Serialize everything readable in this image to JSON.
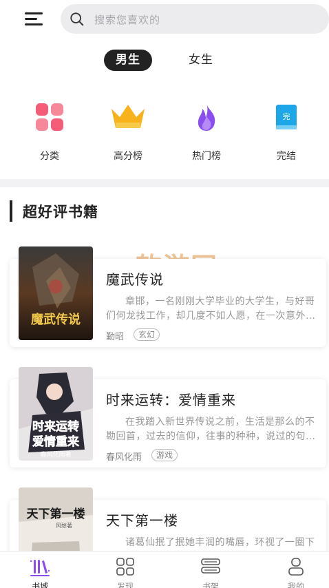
{
  "header": {
    "search_placeholder": "搜索您喜欢的"
  },
  "gender_tabs": {
    "male": "男生",
    "female": "女生",
    "selected": "男生"
  },
  "categories": [
    {
      "label": "分类",
      "icon": "grid-icon",
      "color": "#f2617a"
    },
    {
      "label": "高分榜",
      "icon": "crown-icon",
      "color": "#f7b21c"
    },
    {
      "label": "热门榜",
      "icon": "flame-icon",
      "color": "#8a4ef0"
    },
    {
      "label": "完结",
      "icon": "book-icon",
      "color": "#1ea7e8"
    }
  ],
  "section": {
    "title": "超好评书籍"
  },
  "watermark": "软游网",
  "books": [
    {
      "title": "魔武传说",
      "desc": "章邯，一名刚刚大学毕业的大学生，与好哥们何龙找工作，却几度不如人愿，在一次意外…",
      "author": "勤昭",
      "tag": "玄幻",
      "cover_text": "魔武传说"
    },
    {
      "title": "时来运转：爱情重来",
      "desc": "在我踏入新世界传说之前，生活是那么的不勘回首，过去的信仰，往事的种种，说过的句…",
      "author": "春风化雨",
      "tag": "游戏",
      "cover_text": "时来运转爱情重来"
    },
    {
      "title": "天下第一楼",
      "desc": "诸葛仙抿了抿她丰润的嘴唇，环视了一圈下面无数双渴望的眼睛，开始说道“这是一个传…",
      "author": "",
      "tag": "",
      "cover_text": "天下第一楼"
    }
  ],
  "bottom_nav": [
    {
      "label": "书城",
      "icon": "bookstore-icon",
      "active": true
    },
    {
      "label": "发现",
      "icon": "discover-icon",
      "active": false
    },
    {
      "label": "书架",
      "icon": "bookshelf-icon",
      "active": false
    },
    {
      "label": "我的",
      "icon": "profile-icon",
      "active": false
    }
  ]
}
